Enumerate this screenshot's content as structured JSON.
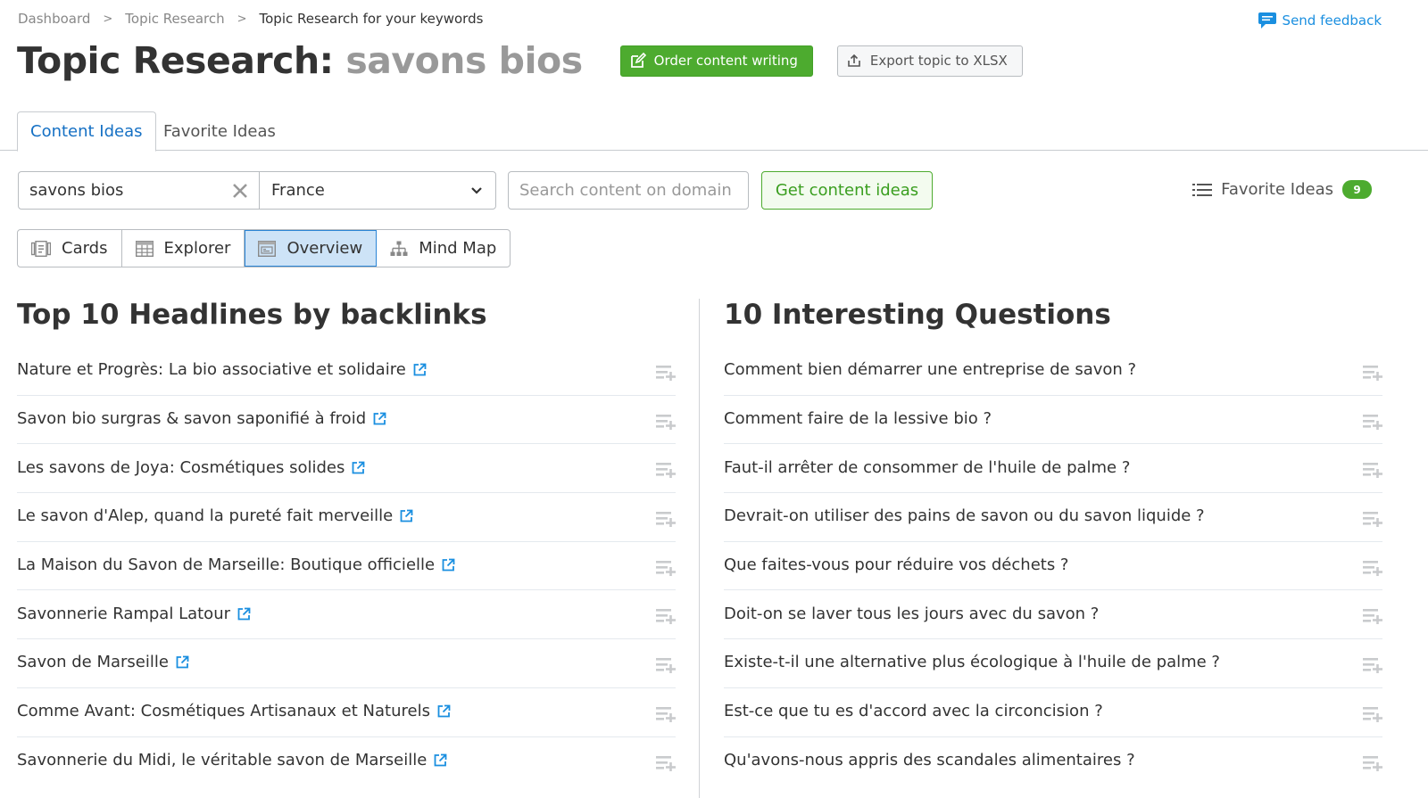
{
  "breadcrumb": [
    "Dashboard",
    "Topic Research",
    "Topic Research for your keywords"
  ],
  "feedback": {
    "label": "Send feedback",
    "icon": "chat-icon"
  },
  "header": {
    "title": "Topic Research:",
    "keyword": "savons bios",
    "order_button": "Order content writing",
    "export_button": "Export topic to XLSX"
  },
  "tabs": [
    {
      "label": "Content Ideas",
      "active": true
    },
    {
      "label": "Favorite Ideas",
      "active": false
    }
  ],
  "controls": {
    "keyword_value": "savons bios",
    "database_value": "France",
    "domain_placeholder": "Search content on domain",
    "get_button": "Get content ideas",
    "favorite_label": "Favorite Ideas",
    "favorite_count": "9"
  },
  "views": [
    {
      "label": "Cards",
      "icon": "cards-icon",
      "active": false
    },
    {
      "label": "Explorer",
      "icon": "table-icon",
      "active": false
    },
    {
      "label": "Overview",
      "icon": "overview-icon",
      "active": true
    },
    {
      "label": "Mind Map",
      "icon": "mindmap-icon",
      "active": false
    }
  ],
  "headlines": {
    "title": "Top 10 Headlines by backlinks",
    "items": [
      "Nature et Progrès: La bio associative et solidaire",
      "Savon bio surgras & savon saponifié à froid",
      "Les savons de Joya: Cosmétiques solides",
      "Le savon d'Alep, quand la pureté fait merveille",
      "La Maison du Savon de Marseille: Boutique officielle",
      "Savonnerie Rampal Latour",
      "Savon de Marseille",
      "Comme Avant: Cosmétiques Artisanaux et Naturels",
      "Savonnerie du Midi, le véritable savon de Marseille"
    ]
  },
  "questions": {
    "title": "10 Interesting Questions",
    "items": [
      "Comment bien démarrer une entreprise de savon ?",
      "Comment faire de la lessive bio ?",
      "Faut-il arrêter de consommer de l'huile de palme ?",
      "Devrait-on utiliser des pains de savon ou du savon liquide ?",
      "Que faites-vous pour réduire vos déchets ?",
      "Doit-on se laver tous les jours avec du savon ?",
      "Existe-t-il une alternative plus écologique à l'huile de palme ?",
      "Est-ce que tu es d'accord avec la circoncision ?",
      "Qu'avons-nous appris des scandales alimentaires ?"
    ]
  },
  "colors": {
    "accent_green": "#4dab2f",
    "link_blue": "#1a8fe0",
    "active_tab_blue": "#1570c4",
    "active_view_bg": "#cde3f7"
  }
}
